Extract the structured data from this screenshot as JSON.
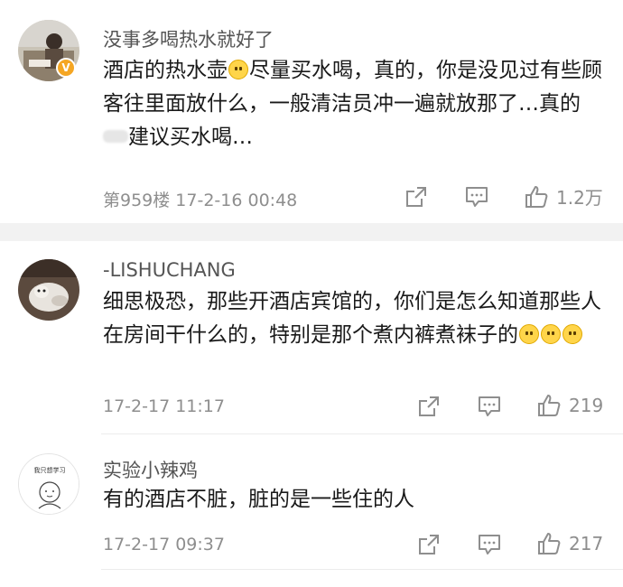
{
  "comments": [
    {
      "username": "没事多喝热水就好了",
      "verified": true,
      "text_part1": "酒店的热水壶",
      "text_part2": "尽量买水喝，真的，你是没见过有些顾客往里面放什么，一般清洁员冲一遍就放那了…真的",
      "text_part3": "建议买水喝…",
      "meta": "第959楼 17-2-16 00:48",
      "like_count": "1.2万"
    },
    {
      "username": "-LISHUCHANG",
      "verified": false,
      "text": "细思极恐，那些开酒店宾馆的，你们是怎么知道那些人在房间干什么的，特别是那个煮内裤煮袜子的",
      "meta": "17-2-17 11:17",
      "like_count": "219"
    },
    {
      "username": "实验小辣鸡",
      "verified": false,
      "text": "有的酒店不脏，脏的是一些住的人",
      "meta": "17-2-17 09:37",
      "like_count": "217"
    }
  ],
  "avatar3_caption": "我只想学习",
  "icons": {
    "share": "share-icon",
    "comment": "comment-icon",
    "like": "thumbs-up-icon",
    "verified": "verified-badge-icon"
  },
  "colors": {
    "meta_text": "#8e8e8e",
    "username": "#555555",
    "verified_badge": "#f5a623",
    "separator": "#f2f2f2"
  }
}
